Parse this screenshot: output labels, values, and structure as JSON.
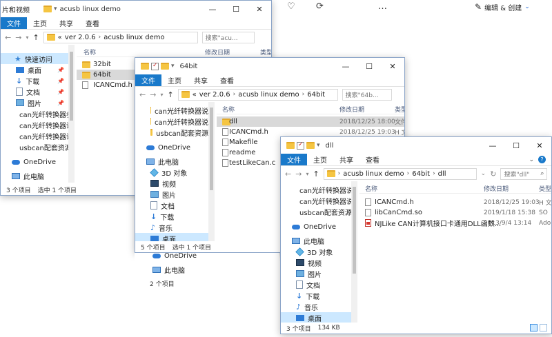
{
  "app": {
    "edit_label": "编辑 & 创建",
    "edit_chevron": "⌄",
    "icons": [
      "heart-icon",
      "rotate-icon",
      "more-icon",
      "edit-magic-icon"
    ]
  },
  "win1": {
    "title": "acusb linux demo",
    "tabs": [
      "文件",
      "主页",
      "共享",
      "查看"
    ],
    "path": [
      "«",
      "ver 2.0.6",
      "acusb linux demo"
    ],
    "search": "搜索\"acu...",
    "sidebar_title_fragment": "片和视频",
    "quick_access": "快速访问",
    "side_items": [
      "桌面",
      "下载",
      "文档",
      "图片",
      "can光纤转换器参",
      "can光纤转换器说",
      "can光纤转换器说",
      "usbcan配套资源"
    ],
    "onedrive": "OneDrive",
    "thispc": "此电脑",
    "headers": {
      "name": "名称",
      "date": "修改日期",
      "type": "类型"
    },
    "files": [
      {
        "name": "32bit",
        "kind": "folder"
      },
      {
        "name": "64bit",
        "kind": "folder",
        "selected": true
      },
      {
        "name": "ICANCmd.h",
        "kind": "file"
      }
    ],
    "status": {
      "count": "3 个项目",
      "selected": "选中 1 个项目"
    }
  },
  "win2": {
    "title": "64bit",
    "tabs": [
      "文件",
      "主页",
      "共享",
      "查看"
    ],
    "path": [
      "«",
      "ver 2.0.6",
      "acusb linux demo",
      "64bit"
    ],
    "search": "搜索\"64b...",
    "side_items": [
      "can光纤转换器说",
      "can光纤转换器说",
      "usbcan配套资源"
    ],
    "onedrive": "OneDrive",
    "thispc": "此电脑",
    "pc_items": [
      "3D 对象",
      "视频",
      "图片",
      "文档",
      "下载",
      "音乐",
      "桌面"
    ],
    "headers": {
      "name": "名称",
      "date": "修改日期",
      "type": "类型"
    },
    "files": [
      {
        "name": "dll",
        "kind": "folder",
        "date": "2018/12/25 18:00",
        "type": "文件",
        "selected": true
      },
      {
        "name": "ICANCmd.h",
        "kind": "file",
        "date": "2018/12/25 19:03",
        "type": "H 文"
      },
      {
        "name": "Makefile",
        "kind": "file",
        "date": "",
        "type": ""
      },
      {
        "name": "readme",
        "kind": "file",
        "date": "",
        "type": ""
      },
      {
        "name": "testLikeCan.c",
        "kind": "file",
        "date": "",
        "type": ""
      }
    ],
    "status": {
      "count": "5 个项目",
      "selected": "选中 1 个项目"
    },
    "below": {
      "onedrive": "OneDrive",
      "thispc": "此电脑",
      "count": "2 个项目"
    }
  },
  "win3": {
    "title": "dll",
    "tabs": [
      "文件",
      "主页",
      "共享",
      "查看"
    ],
    "path": [
      "acusb linux demo",
      "64bit",
      "dll"
    ],
    "search": "搜索\"dll\"",
    "side_items": [
      "can光纤转换器说",
      "can光纤转换器说",
      "usbcan配套资源"
    ],
    "onedrive": "OneDrive",
    "thispc": "此电脑",
    "pc_items": [
      "3D 对象",
      "视频",
      "图片",
      "文档",
      "下载",
      "音乐",
      "桌面"
    ],
    "headers": {
      "name": "名称",
      "date": "修改日期",
      "type": "类型"
    },
    "files": [
      {
        "name": "ICANCmd.h",
        "kind": "file",
        "date": "2018/12/25 19:03",
        "type": "H 文"
      },
      {
        "name": "libCanCmd.so",
        "kind": "file",
        "date": "2019/1/18 15:38",
        "type": "SO"
      },
      {
        "name": "NJLike CAN计算机接口卡通用DLL函数...",
        "kind": "pdf",
        "date": "2013/9/4 13:14",
        "type": "Ado"
      }
    ],
    "status": {
      "count": "3 个项目",
      "size": "134 KB"
    }
  }
}
